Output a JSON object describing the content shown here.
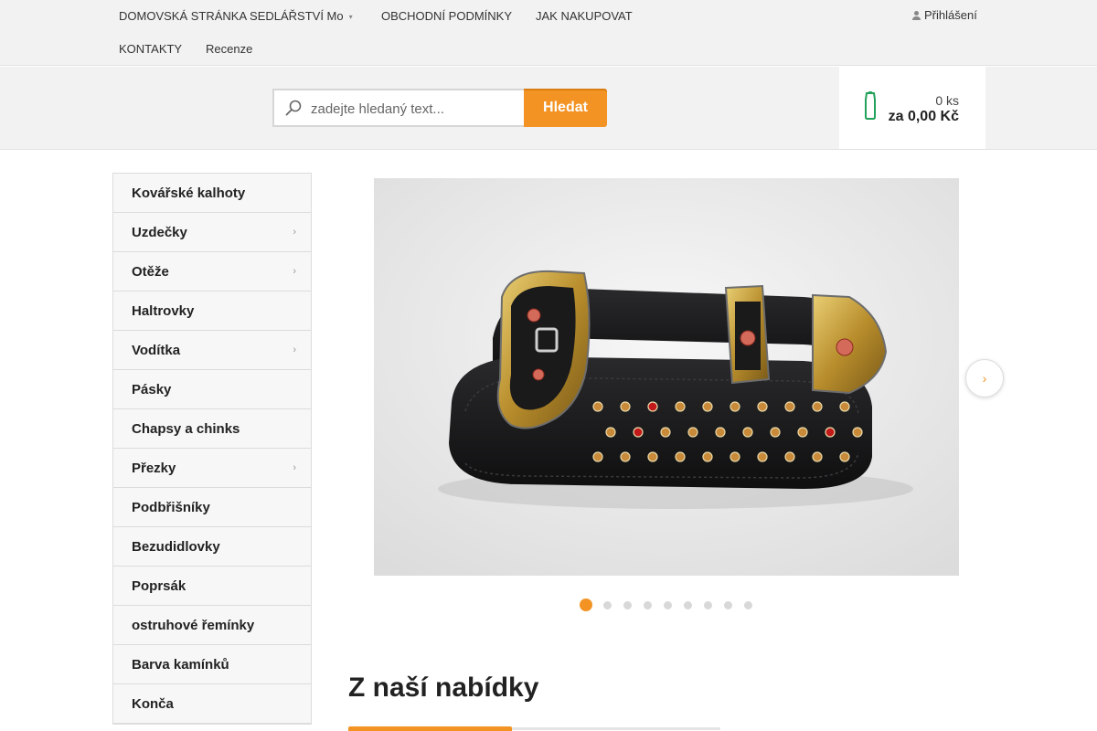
{
  "topnav": {
    "items": [
      {
        "label": "DOMOVSKÁ STRÁNKA SEDLÁŘSTVÍ Mo",
        "has_submenu": true
      },
      {
        "label": "OBCHODNÍ PODMÍNKY"
      },
      {
        "label": "JAK NAKUPOVAT"
      },
      {
        "label": "KONTAKTY"
      },
      {
        "label": "Recenze"
      }
    ],
    "login_label": "Přihlášení",
    "caret": "▾"
  },
  "search": {
    "placeholder": "zadejte hledaný text...",
    "button_label": "Hledat"
  },
  "cart": {
    "count": "0 ks",
    "total": "za 0,00 Kč",
    "icon": "cart-icon"
  },
  "sidebar": {
    "items": [
      {
        "label": "Kovářské kalhoty",
        "chevron": ""
      },
      {
        "label": "Uzdečky",
        "chevron": "›"
      },
      {
        "label": "Otěže",
        "chevron": "›"
      },
      {
        "label": "Haltrovky",
        "chevron": ""
      },
      {
        "label": "Vodítka",
        "chevron": "›"
      },
      {
        "label": "Pásky",
        "chevron": ""
      },
      {
        "label": "Chapsy a chinks",
        "chevron": ""
      },
      {
        "label": "Přezky",
        "chevron": "›"
      },
      {
        "label": "Podbřišníky",
        "chevron": ""
      },
      {
        "label": "Bezudidlovky",
        "chevron": ""
      },
      {
        "label": "Poprsák",
        "chevron": ""
      },
      {
        "label": "ostruhové řemínky",
        "chevron": ""
      },
      {
        "label": "Barva kamínků",
        "chevron": ""
      },
      {
        "label": "Konča",
        "chevron": ""
      }
    ]
  },
  "slider": {
    "next_icon": "›",
    "slide_count": 9,
    "active_slide": 1
  },
  "section": {
    "title": "Z naší nabídky"
  },
  "colors": {
    "accent": "#f39323",
    "cart_icon": "#22a15a",
    "belt_leather": "#1c1c1e",
    "buckle_gold": "#c9a13a",
    "stone_red": "#c21a1a",
    "stone_amber": "#c98a3a"
  }
}
